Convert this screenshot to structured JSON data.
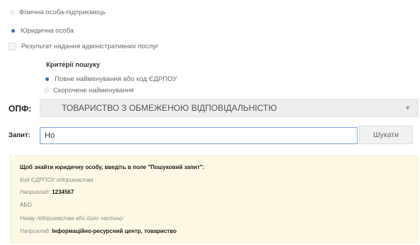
{
  "person_type": {
    "fop_label": "Фізична особа-підприємець",
    "legal_label": "Юридична особа"
  },
  "service_result_label": "Результат надання адміністративних послуг",
  "criteria": {
    "heading": "Критерії пошуку",
    "full_label": "Повне найменування або код ЄДРПОУ",
    "short_label": "Скорочене найменування"
  },
  "opf": {
    "label": "ОПФ:",
    "selected": "ТОВАРИСТВО З ОБМЕЖЕНОЮ ВІДПОВІДАЛЬНІСТЮ"
  },
  "query": {
    "label": "Запит:",
    "value": "Но",
    "search_button": "Шукати"
  },
  "hint": {
    "intro": "Щоб знайти юридичну особу, введіть в поле \"Пошуковий запит\":",
    "code_label": "Код ЄДРПОУ підприємства",
    "example1_prefix": "Наприклад:",
    "example1_value": "1234567",
    "or": "АБО",
    "name_label": "Назву підприємства або його частину",
    "example2_prefix": "Наприклад:",
    "example2_value": "Інформаційно-ресурсний центр, товариство"
  },
  "colors": {
    "accent": "#2f6fb5",
    "hint_bg": "#fcf8e3",
    "input_border": "#78a6d8"
  }
}
